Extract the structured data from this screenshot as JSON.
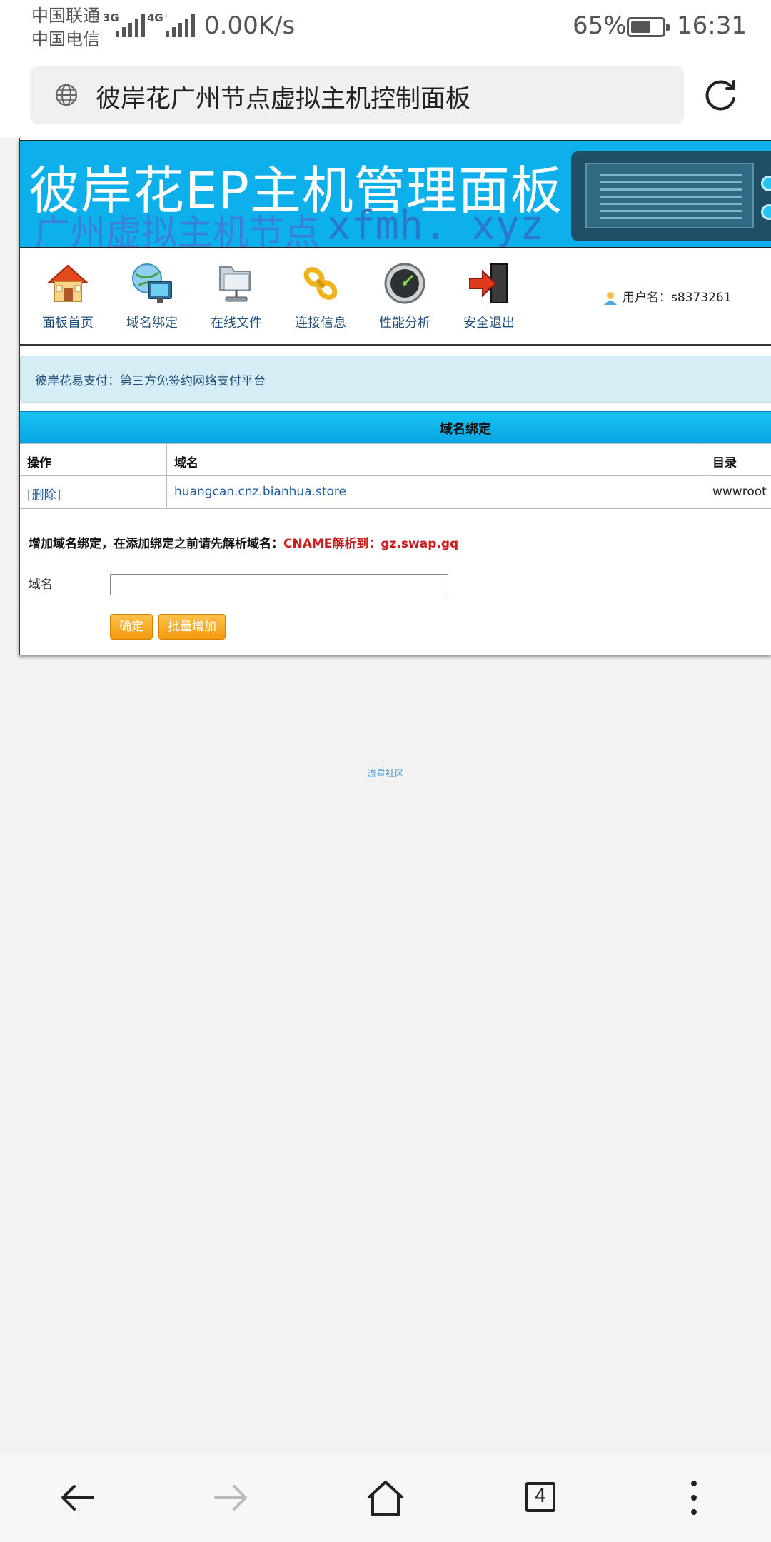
{
  "status_bar": {
    "carrier1": "中国联通",
    "carrier2": "中国电信",
    "net1": "3G",
    "net2": "4G⁺",
    "speed": "0.00K/s",
    "battery_pct": "65%",
    "battery_level": 0.65,
    "time": "16:31"
  },
  "address_bar": {
    "title": "彼岸花广州节点虚拟主机控制面板"
  },
  "banner": {
    "title": "彼岸花EP主机管理面板",
    "subtitle": "广州虚拟主机节点",
    "domain": "xfmh. xyz"
  },
  "nav": {
    "items": [
      {
        "label": "面板首页",
        "icon": "home-icon"
      },
      {
        "label": "域名绑定",
        "icon": "globe-monitor-icon"
      },
      {
        "label": "在线文件",
        "icon": "folder-network-icon"
      },
      {
        "label": "连接信息",
        "icon": "link-chain-icon"
      },
      {
        "label": "性能分析",
        "icon": "gauge-icon"
      },
      {
        "label": "安全退出",
        "icon": "exit-door-icon"
      }
    ],
    "user_label": "用户名：s8373261"
  },
  "notice": {
    "text": "彼岸花易支付：第三方免签约网络支付平台"
  },
  "panel": {
    "title": "域名绑定",
    "headers": [
      "操作",
      "域名",
      "目录"
    ],
    "rows": [
      {
        "action": "[删除]",
        "domain": "huangcan.cnz.bianhua.store",
        "dir": "wwwroot"
      }
    ],
    "hint": "增加域名绑定，在添加绑定之前请先解析域名：",
    "hint_red": "CNAME解析到：gz.swap.gq",
    "form_label": "域名",
    "input_value": "",
    "confirm_label": "确定",
    "batch_label": "批量增加"
  },
  "footer": {
    "link": "流星社区"
  },
  "bottom_nav": {
    "tabs_count": "4"
  },
  "colors": {
    "banner_bg": "#0db0ea",
    "panel_title_bg": "#16c3f4",
    "button_orange": "#f29a10",
    "hint_red": "#cc1c1c",
    "notice_bg": "#d6edf6"
  }
}
